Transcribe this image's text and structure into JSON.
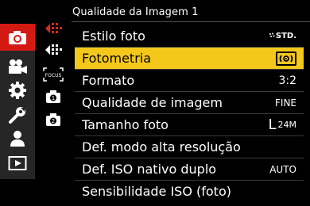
{
  "header": {
    "title": "Qualidade da Imagem 1"
  },
  "left_tabs": [
    {
      "icon": "camera-photo-icon",
      "active": true
    },
    {
      "icon": "movie-camera-icon",
      "active": false
    },
    {
      "icon": "gear-icon",
      "active": false
    },
    {
      "icon": "wrench-icon",
      "active": false
    },
    {
      "icon": "my-menu-person-icon",
      "active": false
    },
    {
      "icon": "playback-icon",
      "active": false
    }
  ],
  "sub_tabs": [
    {
      "icon": "image-quality-page-icon",
      "active": true
    },
    {
      "icon": "image-quality-page-2-icon",
      "active": false
    },
    {
      "icon": "focus-page-icon",
      "label": "FOCUS",
      "active": false
    },
    {
      "icon": "shooting-page-1-icon",
      "label": "1",
      "active": false
    },
    {
      "icon": "shooting-page-2-icon",
      "label": "2",
      "active": false
    }
  ],
  "menu": {
    "items": [
      {
        "label": "Estilo foto",
        "value": "STD."
      },
      {
        "label": "Fotometria",
        "value": "multi-metering-icon",
        "selected": true
      },
      {
        "label": "Formato",
        "value": "3:2"
      },
      {
        "label": "Qualidade de imagem",
        "value": "FINE"
      },
      {
        "label": "Tamanho foto",
        "value": "L",
        "value_sub": "24M"
      },
      {
        "label": "Def. modo alta resolução",
        "value": ""
      },
      {
        "label": "Def. ISO nativo duplo",
        "value": "AUTO"
      },
      {
        "label": "Sensibilidade ISO (foto)",
        "value": ""
      }
    ]
  },
  "colors": {
    "accent_red": "#d31a12",
    "highlight_yellow": "#f4c81a",
    "sidebar_gray": "#262626"
  }
}
